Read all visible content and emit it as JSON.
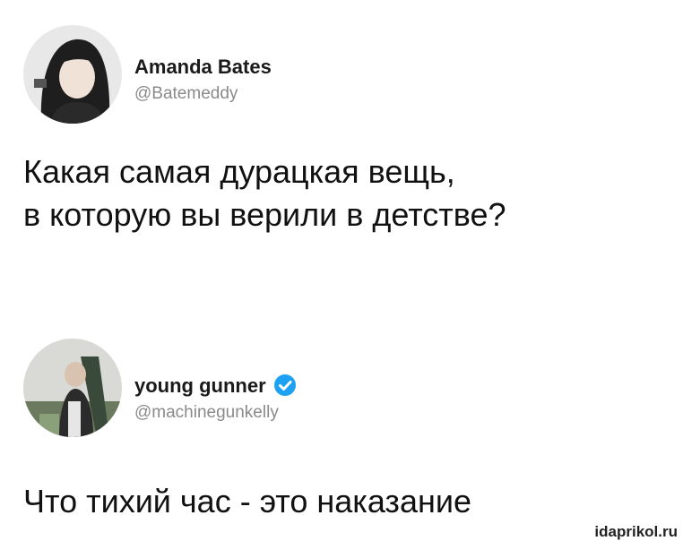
{
  "tweets": [
    {
      "author_name": "Amanda Bates",
      "handle": "@Batemeddy",
      "verified": false,
      "text_lines": [
        "Какая самая дурацкая вещь,",
        "в которую вы верили в детстве?"
      ]
    },
    {
      "author_name": "young gunner",
      "handle": "@machinegunkelly",
      "verified": true,
      "text_lines": [
        "Что тихий час - это наказание"
      ]
    }
  ],
  "watermark": "idaprikol.ru",
  "colors": {
    "verified_badge": "#1da1f2",
    "handle": "#8a8a8a"
  },
  "icons": {
    "verified": "verified-badge-icon"
  }
}
